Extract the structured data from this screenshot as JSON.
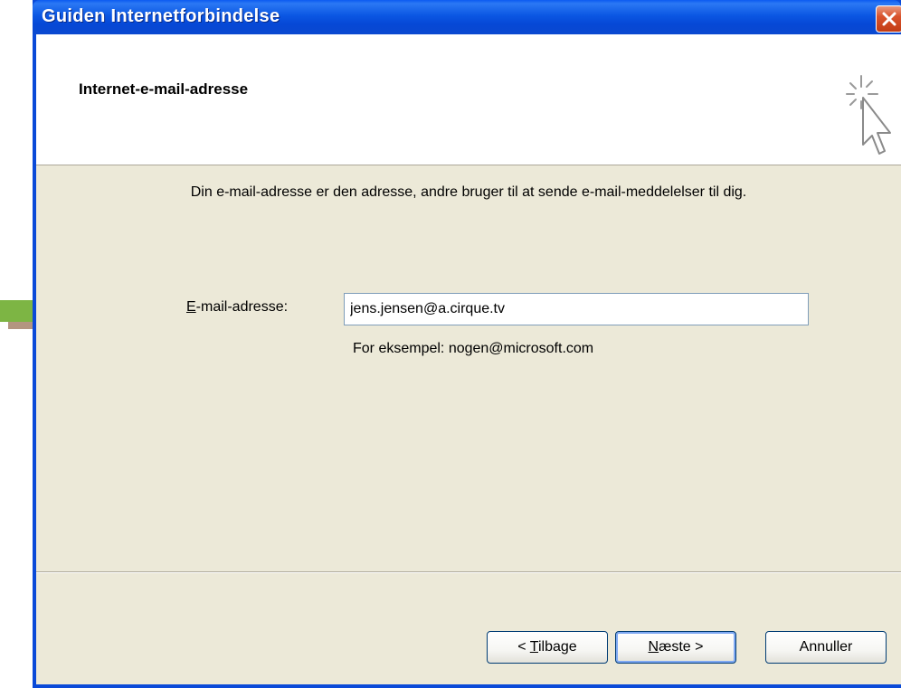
{
  "window": {
    "title": "Guiden Internetforbindelse"
  },
  "header": {
    "title": "Internet-e-mail-adresse",
    "icon": "wizard-cursor-icon"
  },
  "body": {
    "description": "Din e-mail-adresse er den adresse, andre bruger til at sende e-mail-meddelelser til dig.",
    "email_label_mnemonic": "E",
    "email_label_rest": "-mail-adresse:",
    "email_value": "jens.jensen@a.cirque.tv",
    "example": "For eksempel: nogen@microsoft.com"
  },
  "buttons": {
    "back_prefix": "< ",
    "back_mnemonic": "T",
    "back_rest": "ilbage",
    "next_mnemonic": "N",
    "next_rest": "æste >",
    "cancel": "Annuller"
  },
  "annotation": {
    "arrow_color": "#7DB544",
    "arrow_shadow": "#B39580"
  },
  "colors": {
    "titlebar": "#0A4AD8",
    "dialog_bg": "#ECE9D8",
    "close_button": "#D9532D"
  }
}
